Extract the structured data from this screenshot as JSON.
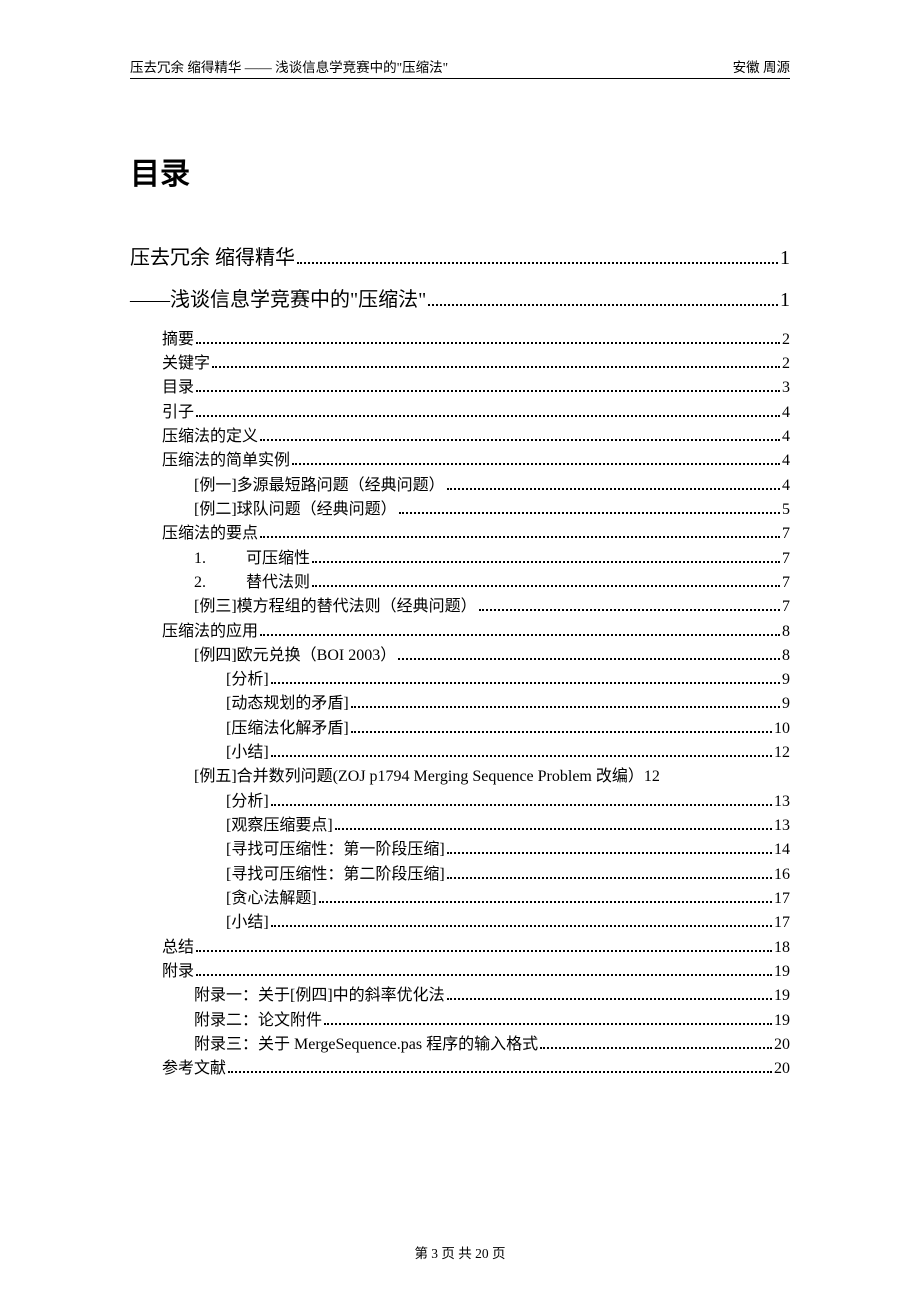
{
  "header": {
    "left": "压去冗余 缩得精华 —— 浅谈信息学竞赛中的\"压缩法\"",
    "right": "安徽 周源"
  },
  "toc_heading": "目录",
  "entries": [
    {
      "level": "big",
      "label": "压去冗余 缩得精华",
      "page": "1"
    },
    {
      "level": "big",
      "label": "——浅谈信息学竞赛中的\"压缩法\"",
      "page": "1"
    },
    {
      "level": 1,
      "label": "摘要",
      "page": "2"
    },
    {
      "level": 1,
      "label": "关键字",
      "page": "2"
    },
    {
      "level": 1,
      "label": "目录",
      "page": "3"
    },
    {
      "level": 1,
      "label": "引子",
      "page": "4"
    },
    {
      "level": 1,
      "label": "压缩法的定义",
      "page": "4"
    },
    {
      "level": 1,
      "label": "压缩法的简单实例",
      "page": "4"
    },
    {
      "level": 2,
      "label": "[例一]多源最短路问题（经典问题）",
      "page": "4"
    },
    {
      "level": 2,
      "label": "[例二]球队问题（经典问题）",
      "page": "5"
    },
    {
      "level": 1,
      "label": "压缩法的要点",
      "page": "7"
    },
    {
      "level": 2,
      "num": "1.",
      "label": "可压缩性",
      "page": "7"
    },
    {
      "level": 2,
      "num": "2.",
      "label": "替代法则",
      "page": "7"
    },
    {
      "level": 2,
      "label": "[例三]模方程组的替代法则（经典问题）",
      "page": "7"
    },
    {
      "level": 1,
      "label": "压缩法的应用",
      "page": "8"
    },
    {
      "level": 2,
      "label": "[例四]欧元兑换（BOI 2003）",
      "page": "8"
    },
    {
      "level": 3,
      "label": "[分析]",
      "page": "9"
    },
    {
      "level": 3,
      "label": "[动态规划的矛盾]",
      "page": "9"
    },
    {
      "level": 3,
      "label": "[压缩法化解矛盾]",
      "page": "10"
    },
    {
      "level": 3,
      "label": "[小结]",
      "page": "12"
    },
    {
      "level": 2,
      "label": "[例五]合并数列问题(ZOJ p1794 Merging Sequence Problem 改编）",
      "page": "12",
      "nodots": true
    },
    {
      "level": 3,
      "label": "[分析]",
      "page": "13"
    },
    {
      "level": 3,
      "label": "[观察压缩要点]",
      "page": "13"
    },
    {
      "level": 3,
      "label": "[寻找可压缩性：第一阶段压缩]",
      "page": "14"
    },
    {
      "level": 3,
      "label": "[寻找可压缩性：第二阶段压缩]",
      "page": "16"
    },
    {
      "level": 3,
      "label": "[贪心法解题]",
      "page": "17"
    },
    {
      "level": 3,
      "label": "[小结]",
      "page": "17"
    },
    {
      "level": 1,
      "label": "总结",
      "page": "18"
    },
    {
      "level": 1,
      "label": "附录",
      "page": "19"
    },
    {
      "level": 2,
      "label": "附录一：关于[例四]中的斜率优化法",
      "page": "19"
    },
    {
      "level": 2,
      "label": "附录二：论文附件",
      "page": "19"
    },
    {
      "level": 2,
      "label": "附录三：关于 MergeSequence.pas 程序的输入格式",
      "page": "20"
    },
    {
      "level": 1,
      "label": "参考文献",
      "page": "20"
    }
  ],
  "footer": {
    "text": "第 3 页 共 20 页"
  }
}
